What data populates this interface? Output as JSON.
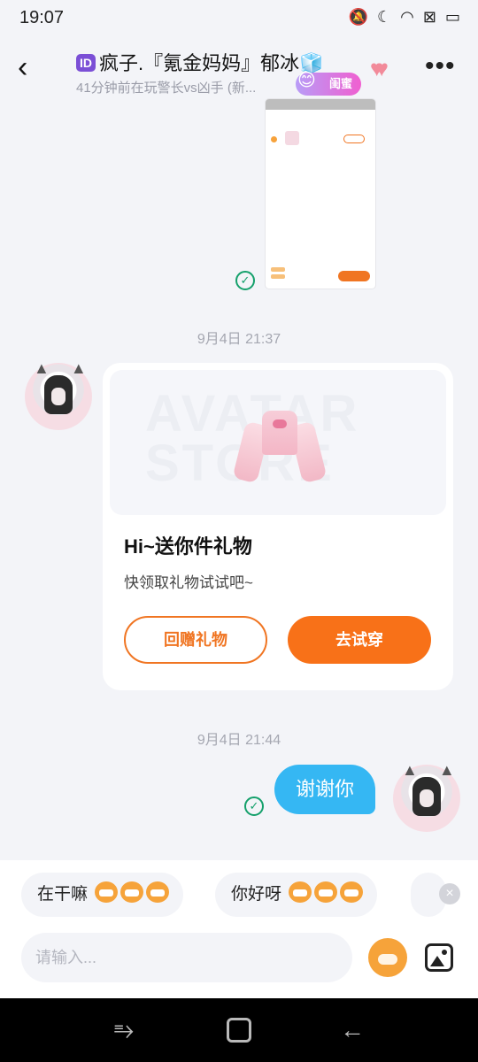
{
  "status_bar": {
    "time": "19:07",
    "icons": [
      "mute-icon",
      "dnd-moon-icon",
      "wifi-icon",
      "sim-off-icon",
      "battery-icon"
    ]
  },
  "header": {
    "id_badge": "ID",
    "title": "疯子.『氪金妈妈』郁冰🧊",
    "subtitle": "41分钟前在玩警长vs凶手 (新...",
    "relation_badge": "闺蜜"
  },
  "messages": {
    "timestamp_1": "9月4日 21:37",
    "gift_card": {
      "title": "Hi~送你件礼物",
      "description": "快领取礼物试试吧~",
      "return_gift_label": "回赠礼物",
      "try_on_label": "去试穿",
      "banner_watermark": "AVATAR STORE"
    },
    "timestamp_2": "9月4日 21:44",
    "my_message": "谢谢你"
  },
  "quick_replies": [
    "在干嘛",
    "你好呀"
  ],
  "input": {
    "placeholder": "请输入..."
  },
  "colors": {
    "accent_orange": "#f87118",
    "my_bubble": "#35b7f3",
    "read_check": "#14a06b"
  }
}
